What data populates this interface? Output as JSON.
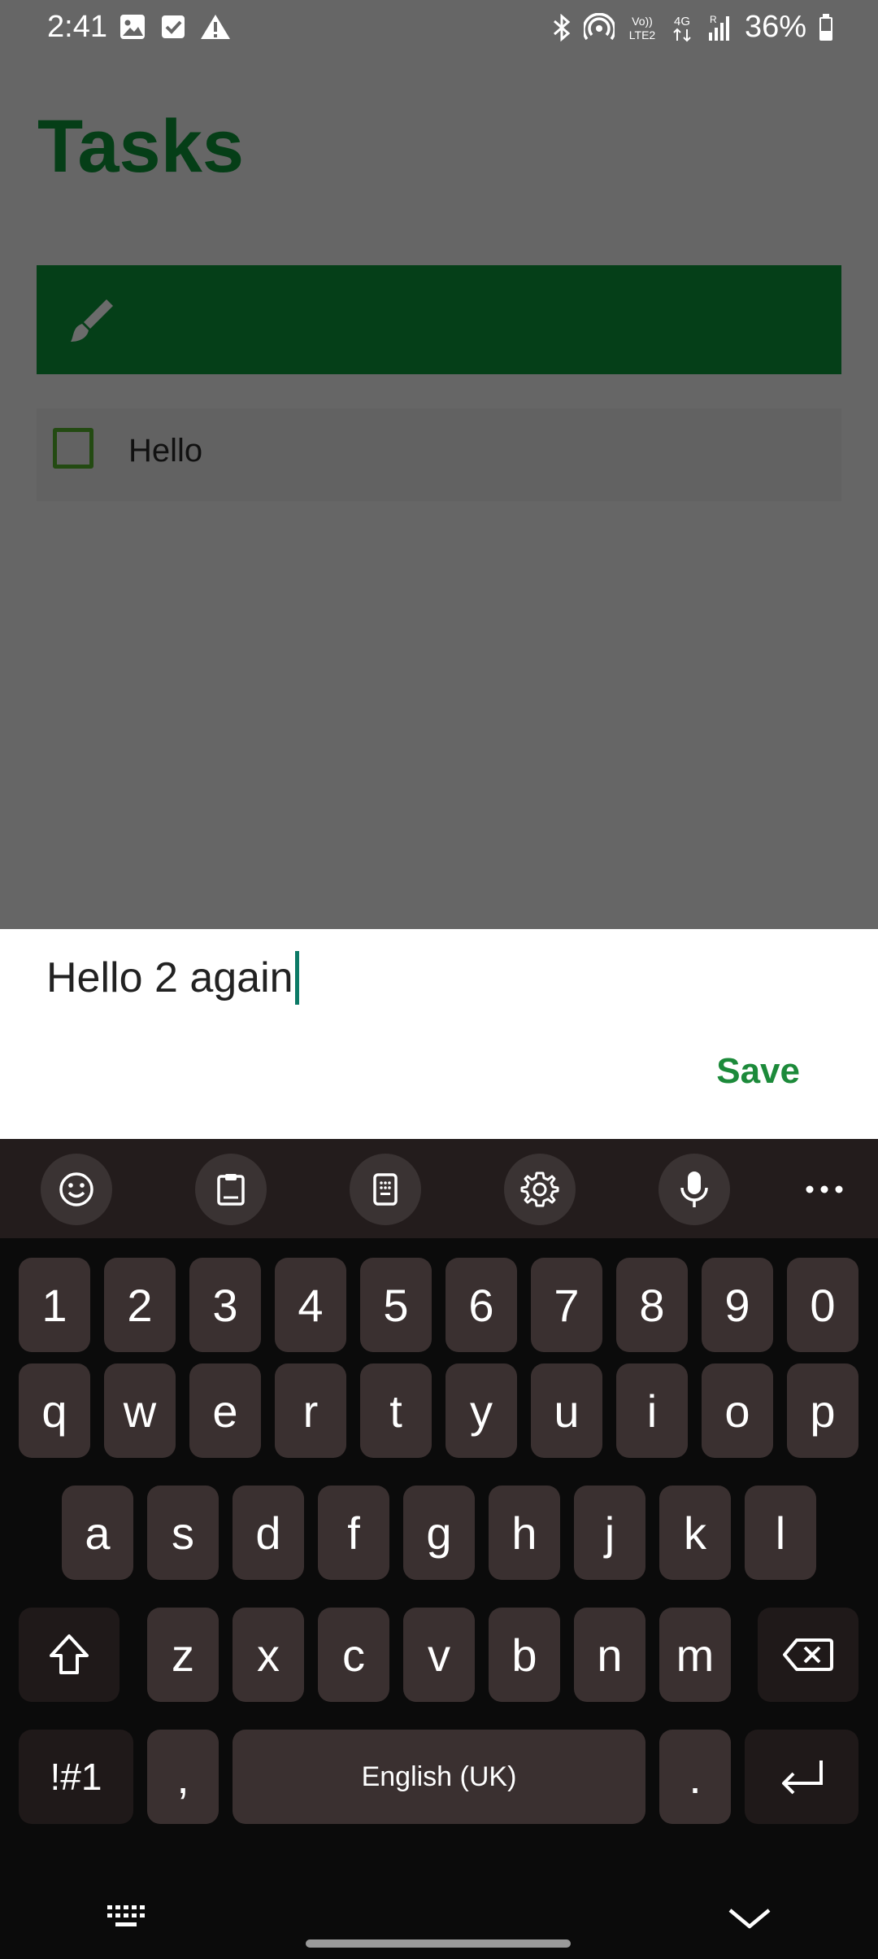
{
  "status_bar": {
    "time": "2:41",
    "battery": "36%",
    "left_icons": [
      "image-icon",
      "check-box-icon",
      "warning-icon"
    ],
    "right_icons": [
      "bluetooth-icon",
      "hotspot-icon",
      "volte-icon",
      "4g-data-icon",
      "signal-icon",
      "battery-icon"
    ],
    "volte_label_top": "Vo))",
    "volte_label_bottom": "LTE2",
    "network_label": "4G",
    "signal_label": "R"
  },
  "app": {
    "title": "Tasks",
    "input_bar_icon": "brush-icon",
    "accent_color": "#053f18",
    "tasks": [
      {
        "label": "Hello",
        "checked": false
      }
    ]
  },
  "sheet": {
    "input_value": "Hello 2 again",
    "save_label": "Save",
    "save_color": "#1c8a3a"
  },
  "keyboard": {
    "toolbar": [
      "emoji-icon",
      "clipboard-icon",
      "keyboard-mode-icon",
      "settings-icon",
      "mic-icon",
      "more-icon"
    ],
    "row_numbers": [
      "1",
      "2",
      "3",
      "4",
      "5",
      "6",
      "7",
      "8",
      "9",
      "0"
    ],
    "row_1": [
      "q",
      "w",
      "e",
      "r",
      "t",
      "y",
      "u",
      "i",
      "o",
      "p"
    ],
    "row_2": [
      "a",
      "s",
      "d",
      "f",
      "g",
      "h",
      "j",
      "k",
      "l"
    ],
    "row_3": [
      "z",
      "x",
      "c",
      "v",
      "b",
      "n",
      "m"
    ],
    "symbols_label": "!#1",
    "comma_label": ",",
    "space_label": "English (UK)",
    "period_label": "."
  }
}
